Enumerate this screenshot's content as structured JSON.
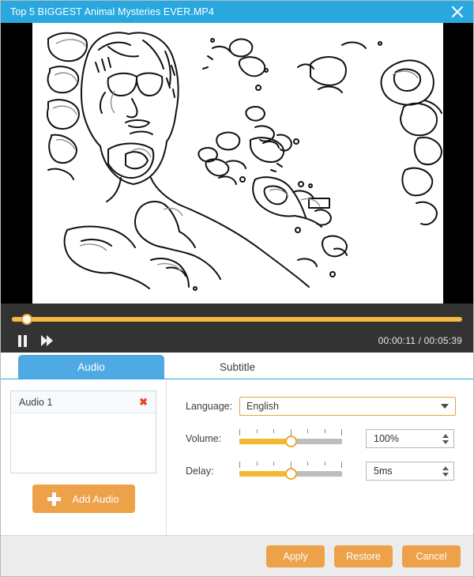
{
  "titlebar": {
    "title": "Top 5 BIGGEST Animal Mysteries EVER.MP4",
    "close_icon": "close-icon",
    "bg_color": "#29a8e0"
  },
  "player": {
    "progress_percent": 3.3,
    "pause_icon": "pause-icon",
    "forward_icon": "fast-forward-icon",
    "current_time": "00:00:11",
    "separator": "/",
    "total_time": "00:05:39",
    "time_display": "00:00:11 / 00:05:39",
    "accent_color": "#f5b945",
    "bg_color": "#333333"
  },
  "tabs": [
    {
      "label": "Audio",
      "active": true
    },
    {
      "label": "Subtitle",
      "active": false
    }
  ],
  "audio_panel": {
    "tracks": [
      {
        "name": "Audio 1",
        "remove_icon": "close-icon",
        "remove_label": "✖"
      }
    ],
    "add_button": {
      "label": "Add Audio",
      "icon": "plus-icon"
    }
  },
  "settings": {
    "language": {
      "label": "Language:",
      "value": "English",
      "caret_icon": "chevron-down-icon"
    },
    "volume": {
      "label": "Volume:",
      "value": "100%",
      "slider_percent": 50
    },
    "delay": {
      "label": "Delay:",
      "value": "5ms",
      "slider_percent": 50
    }
  },
  "footer": {
    "apply_label": "Apply",
    "restore_label": "Restore",
    "cancel_label": "Cancel",
    "button_color": "#eda149"
  }
}
